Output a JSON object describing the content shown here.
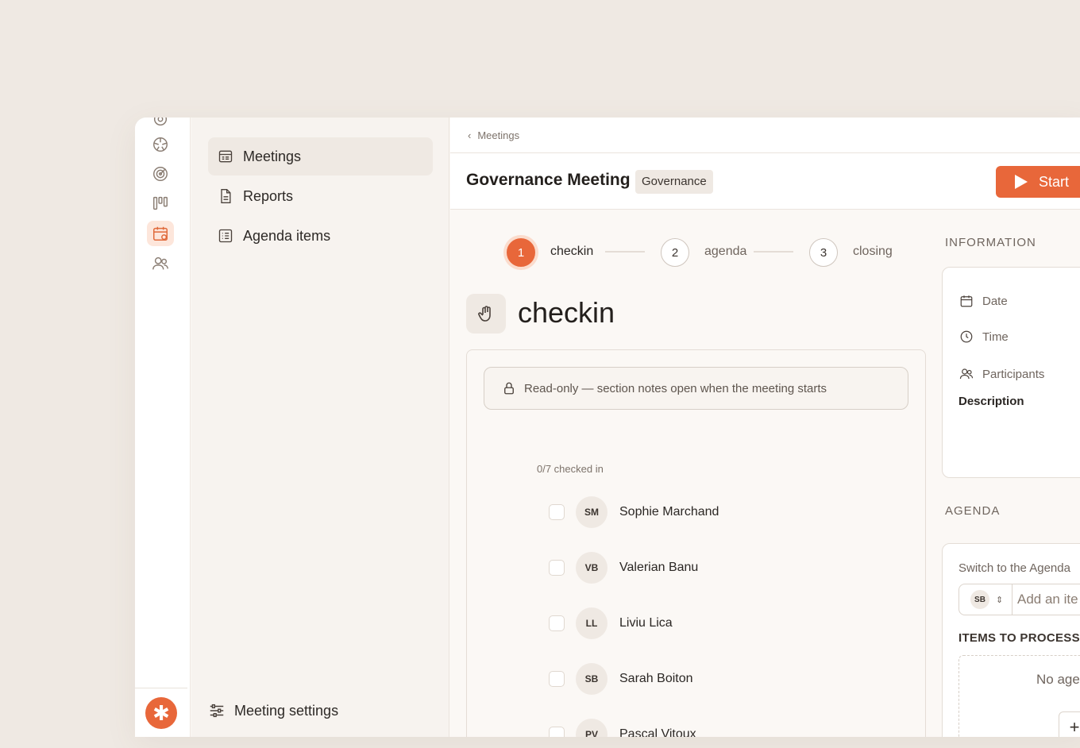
{
  "breadcrumb": {
    "label": "Meetings"
  },
  "sidebar": {
    "items": [
      {
        "label": "Meetings",
        "icon": "meetings-icon"
      },
      {
        "label": "Reports",
        "icon": "document-icon"
      },
      {
        "label": "Agenda items",
        "icon": "list-icon"
      }
    ],
    "settings_label": "Meeting settings"
  },
  "header": {
    "title": "Governance Meeting",
    "tag": "Governance",
    "start_label": "Start"
  },
  "stepper": {
    "steps": [
      {
        "number": "1",
        "label": "checkin"
      },
      {
        "number": "2",
        "label": "agenda"
      },
      {
        "number": "3",
        "label": "closing"
      }
    ]
  },
  "section": {
    "title": "checkin",
    "readonly_notice": "Read-only — section notes open when the meeting starts",
    "checked_in": "0/7 checked in",
    "participants": [
      {
        "initials": "SM",
        "name": "Sophie Marchand"
      },
      {
        "initials": "VB",
        "name": "Valerian Banu"
      },
      {
        "initials": "LL",
        "name": "Liviu Lica"
      },
      {
        "initials": "SB",
        "name": "Sarah Boiton"
      },
      {
        "initials": "PV",
        "name": "Pascal Vitoux"
      }
    ]
  },
  "information": {
    "heading": "INFORMATION",
    "date_label": "Date",
    "time_label": "Time",
    "participants_label": "Participants",
    "description_label": "Description"
  },
  "agenda": {
    "heading": "AGENDA",
    "switch_label": "Switch to the Agenda",
    "owner_initials": "SB",
    "add_placeholder": "Add an ite",
    "items_label": "ITEMS TO PROCESS",
    "empty_text": "No age",
    "add_icon": "+"
  },
  "colors": {
    "accent": "#e8673a",
    "background": "#efe9e3"
  }
}
